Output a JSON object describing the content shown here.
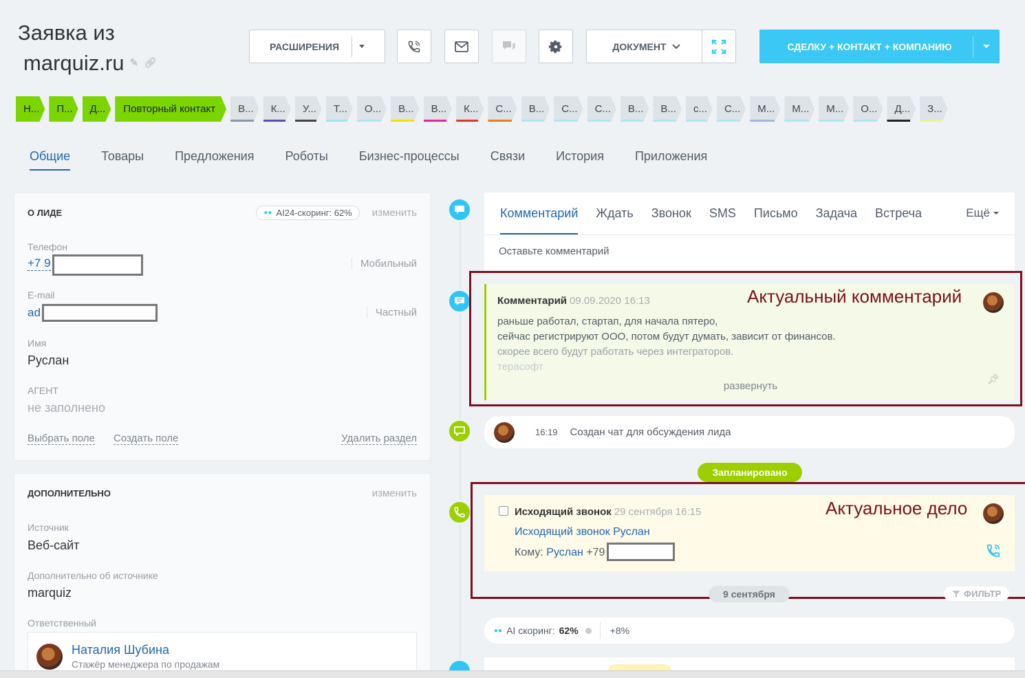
{
  "header": {
    "title_line1": "Заявка из",
    "title_line2": "marquiz.ru",
    "extensions_label": "РАСШИРЕНИЯ",
    "document_label": "ДОКУМЕНТ",
    "convert_label": "СДЕЛКУ + КОНТАКТ + КОМПАНИЮ",
    "accent": "#3bc8f5"
  },
  "stages": [
    {
      "label": "Н...",
      "done": true
    },
    {
      "label": "П...",
      "done": true
    },
    {
      "label": "Д...",
      "done": true
    },
    {
      "label": "Повторный контакт",
      "done": true
    },
    {
      "label": "В...",
      "color": "#8a9aa5"
    },
    {
      "label": "К...",
      "color": "#5b4bb5"
    },
    {
      "label": "У...",
      "color": "#444444"
    },
    {
      "label": "Т...",
      "color": "#9fe3f5"
    },
    {
      "label": "О...",
      "color": "#aee6f5"
    },
    {
      "label": "В...",
      "color": "#f1e500"
    },
    {
      "label": "В...",
      "color": "#e1269b"
    },
    {
      "label": "К...",
      "color": "#d73a2a"
    },
    {
      "label": "С...",
      "color": "#f07820"
    },
    {
      "label": "В...",
      "color": "#aee6f5"
    },
    {
      "label": "С...",
      "color": "#aee6f5"
    },
    {
      "label": "С...",
      "color": "#aee6f5"
    },
    {
      "label": "В...",
      "color": "#aee6f5"
    },
    {
      "label": "В...",
      "color": "#aee6f5"
    },
    {
      "label": "с...",
      "color": "#aee6f5"
    },
    {
      "label": "С...",
      "color": "#aee6f5"
    },
    {
      "label": "М...",
      "color": "#a0b8d8"
    },
    {
      "label": "М...",
      "color": "#aee6f5"
    },
    {
      "label": "М...",
      "color": "#aee6f5"
    },
    {
      "label": "О...",
      "color": "#aee6f5"
    },
    {
      "label": "Д...",
      "color": "#222222"
    },
    {
      "label": "З...",
      "color": "#e9f59b"
    }
  ],
  "tabs": [
    "Общие",
    "Товары",
    "Предложения",
    "Роботы",
    "Бизнес-процессы",
    "Связи",
    "История",
    "Приложения"
  ],
  "about": {
    "title": "О ЛИДЕ",
    "scoring": "AI24-скоринг: 62%",
    "change": "изменить",
    "phone_label": "Телефон",
    "phone_value": "+7 9",
    "phone_type": "Мобильный",
    "email_label": "E-mail",
    "email_value": "ad",
    "email_type": "Частный",
    "name_label": "Имя",
    "name_value": "Руслан",
    "agent_label": "АГЕНТ",
    "agent_value": "не заполнено",
    "select_field": "Выбрать поле",
    "create_field": "Создать поле",
    "delete_section": "Удалить раздел"
  },
  "extra": {
    "title": "ДОПОЛНИТЕЛЬНО",
    "change": "изменить",
    "source_label": "Источник",
    "source_value": "Веб-сайт",
    "source_more_label": "Дополнительно об источнике",
    "source_more_value": "marquiz",
    "responsible_label": "Ответственный",
    "responsible_name": "Наталия Шубина",
    "responsible_role": "Стажёр менеджера по продажам"
  },
  "editor": {
    "tabs": [
      "Комментарий",
      "Ждать",
      "Звонок",
      "SMS",
      "Письмо",
      "Задача",
      "Встреча"
    ],
    "more": "Ещё",
    "placeholder": "Оставьте комментарий"
  },
  "pinned_comment": {
    "title": "Комментарий",
    "date": "09.09.2020 16:13",
    "line1": "раньше работал, стартап, для начала пятеро,",
    "line2": "сейчас регистрируют ООО, потом будут думать, зависит от финансов.",
    "line3": "скорее всего будут работать через интеграторов.",
    "line4": "терасофт",
    "expand": "развернуть",
    "annotation": "Актуальный комментарий"
  },
  "chat_event": {
    "time": "16:19",
    "text": "Создан чат для обсуждения лида"
  },
  "planned_label": "Запланировано",
  "call_task": {
    "title": "Исходящий звонок",
    "date": "29 сентября 16:15",
    "subject": "Исходящий звонок Руслан",
    "to_label": "Кому:",
    "to_name": "Руслан",
    "to_phone": "+79",
    "annotation": "Актуальное дело"
  },
  "date_divider": "9 сентября",
  "filter_label": "ФИЛЬТР",
  "scoring_event": {
    "label": "AI скоринг:",
    "value": "62%",
    "delta": "+8%"
  }
}
